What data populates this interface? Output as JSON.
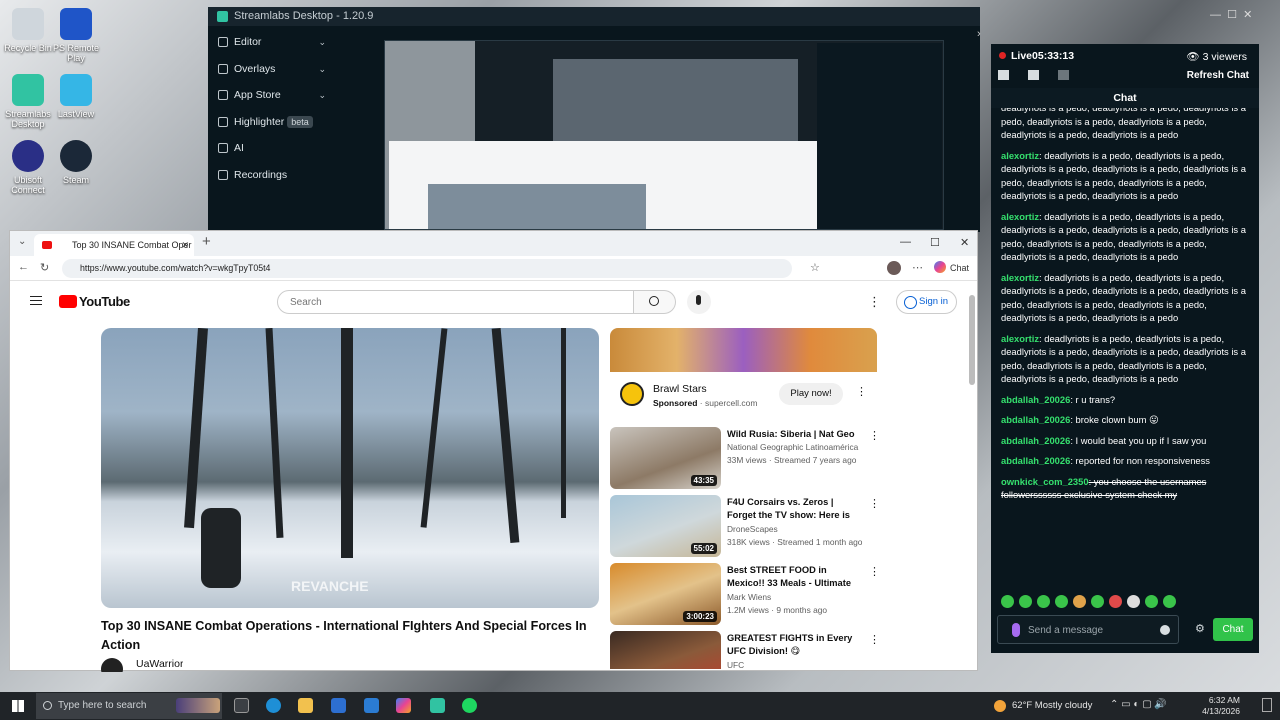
{
  "desktop": {
    "icons": [
      {
        "label": "Recycle Bin",
        "icon": "recycle-bin-icon"
      },
      {
        "label": "PS Remote Play",
        "icon": "ps-remote-play-icon"
      },
      {
        "label": "Streamlabs Desktop",
        "icon": "streamlabs-icon"
      },
      {
        "label": "LastView",
        "icon": "lastview-icon"
      },
      {
        "label": "Ubisoft Connect",
        "icon": "ubisoft-icon"
      },
      {
        "label": "Steam",
        "icon": "steam-icon"
      }
    ]
  },
  "streamlabs": {
    "title": "Streamlabs Desktop - 1.20.9",
    "nav": [
      {
        "label": "Editor",
        "icon": "editor-icon",
        "has_chevron": true
      },
      {
        "label": "Overlays",
        "icon": "overlays-icon",
        "has_chevron": true
      },
      {
        "label": "App Store",
        "icon": "app-store-icon",
        "has_chevron": true
      },
      {
        "label": "Highlighter",
        "icon": "highlighter-icon",
        "badge": "beta"
      },
      {
        "label": "AI",
        "icon": "ai-icon"
      },
      {
        "label": "Recordings",
        "icon": "recordings-icon"
      }
    ],
    "status": {
      "live_label": "Live",
      "live_time": "05:33:13",
      "viewers": "3 viewers"
    },
    "refresh_label": "Refresh Chat",
    "chat_header": "Chat",
    "messages": [
      {
        "user": "",
        "text": "deadlyriots is a pedo, deadlyriots is a pedo, deadlyriots is a pedo, deadlyriots is a pedo, deadlyriots is a pedo, deadlyriots is a pedo, deadlyriots is a pedo"
      },
      {
        "user": "alexortiz",
        "text": ": deadlyriots is a pedo, deadlyriots is a pedo, deadlyriots is a pedo, deadlyriots is a pedo, deadlyriots is a pedo, deadlyriots is a pedo, deadlyriots is a pedo, deadlyriots is a pedo, deadlyriots is a pedo"
      },
      {
        "user": "alexortiz",
        "text": ": deadlyriots is a pedo, deadlyriots is a pedo, deadlyriots is a pedo, deadlyriots is a pedo, deadlyriots is a pedo, deadlyriots is a pedo, deadlyriots is a pedo, deadlyriots is a pedo, deadlyriots is a pedo"
      },
      {
        "user": "alexortiz",
        "text": ": deadlyriots is a pedo, deadlyriots is a pedo, deadlyriots is a pedo, deadlyriots is a pedo, deadlyriots is a pedo, deadlyriots is a pedo, deadlyriots is a pedo, deadlyriots is a pedo, deadlyriots is a pedo"
      },
      {
        "user": "alexortiz",
        "text": ": deadlyriots is a pedo, deadlyriots is a pedo, deadlyriots is a pedo, deadlyriots is a pedo, deadlyriots is a pedo, deadlyriots is a pedo, deadlyriots is a pedo, deadlyriots is a pedo, deadlyriots is a pedo"
      },
      {
        "user": "abdallah_20026",
        "text": ": r u trans?"
      },
      {
        "user": "abdallah_20026",
        "text": ": broke clown bum 😛"
      },
      {
        "user": "abdallah_20026",
        "text": ": I would beat you up if I saw you"
      },
      {
        "user": "abdallah_20026",
        "text": ": reported for non responsiveness"
      },
      {
        "user": "ownkick_com_2350",
        "text": ": you choose the usernames followerssssss exclusive system check my",
        "strike": true
      }
    ],
    "input_placeholder": "Send a message",
    "chat_button": "Chat",
    "colors": {
      "accent": "#31c34a",
      "username": "#35e06e",
      "panel": "#09161d"
    }
  },
  "browser": {
    "tab_title": "Top 30 INSANE Combat Oper",
    "url": "https://www.youtube.com/watch?v=wkgTpyT05t4",
    "edge_chat": "Chat",
    "youtube": {
      "logo": "YouTube",
      "search_placeholder": "Search",
      "sign_in": "Sign in",
      "video_title": "Top 30 INSANE Combat Operations - International FIghters And Special Forces In Action",
      "channel": "UaWarrior",
      "watermark": "REVANCHE",
      "ad": {
        "name": "Brawl Stars",
        "sponsored": "Sponsored",
        "domain": "supercell.com",
        "cta": "Play now!"
      },
      "recommendations": [
        {
          "title": "Wild Rusia: Siberia | Nat Geo",
          "channel": "National Geographic Latinoamérica",
          "meta": "33M views · Streamed 7 years ago",
          "duration": "43:35"
        },
        {
          "title": "F4U Corsairs vs. Zeros | Forget the TV show: Here is what the ...",
          "channel": "DroneScapes",
          "meta": "318K views · Streamed 1 month ago",
          "duration": "55:02"
        },
        {
          "title": "Best STREET FOOD in Mexico!! 33 Meals - Ultimate Mexican ...",
          "channel": "Mark Wiens",
          "meta": "1.2M views · 9 months ago",
          "duration": "3:00:23"
        },
        {
          "title": "GREATEST FIGHTS in Every UFC Division! 😋",
          "channel": "UFC",
          "meta": "",
          "duration": ""
        }
      ]
    }
  },
  "taskbar": {
    "search_placeholder": "Type here to search",
    "weather": "62°F  Mostly cloudy",
    "time": "6:32 AM",
    "date": "4/13/2026"
  }
}
